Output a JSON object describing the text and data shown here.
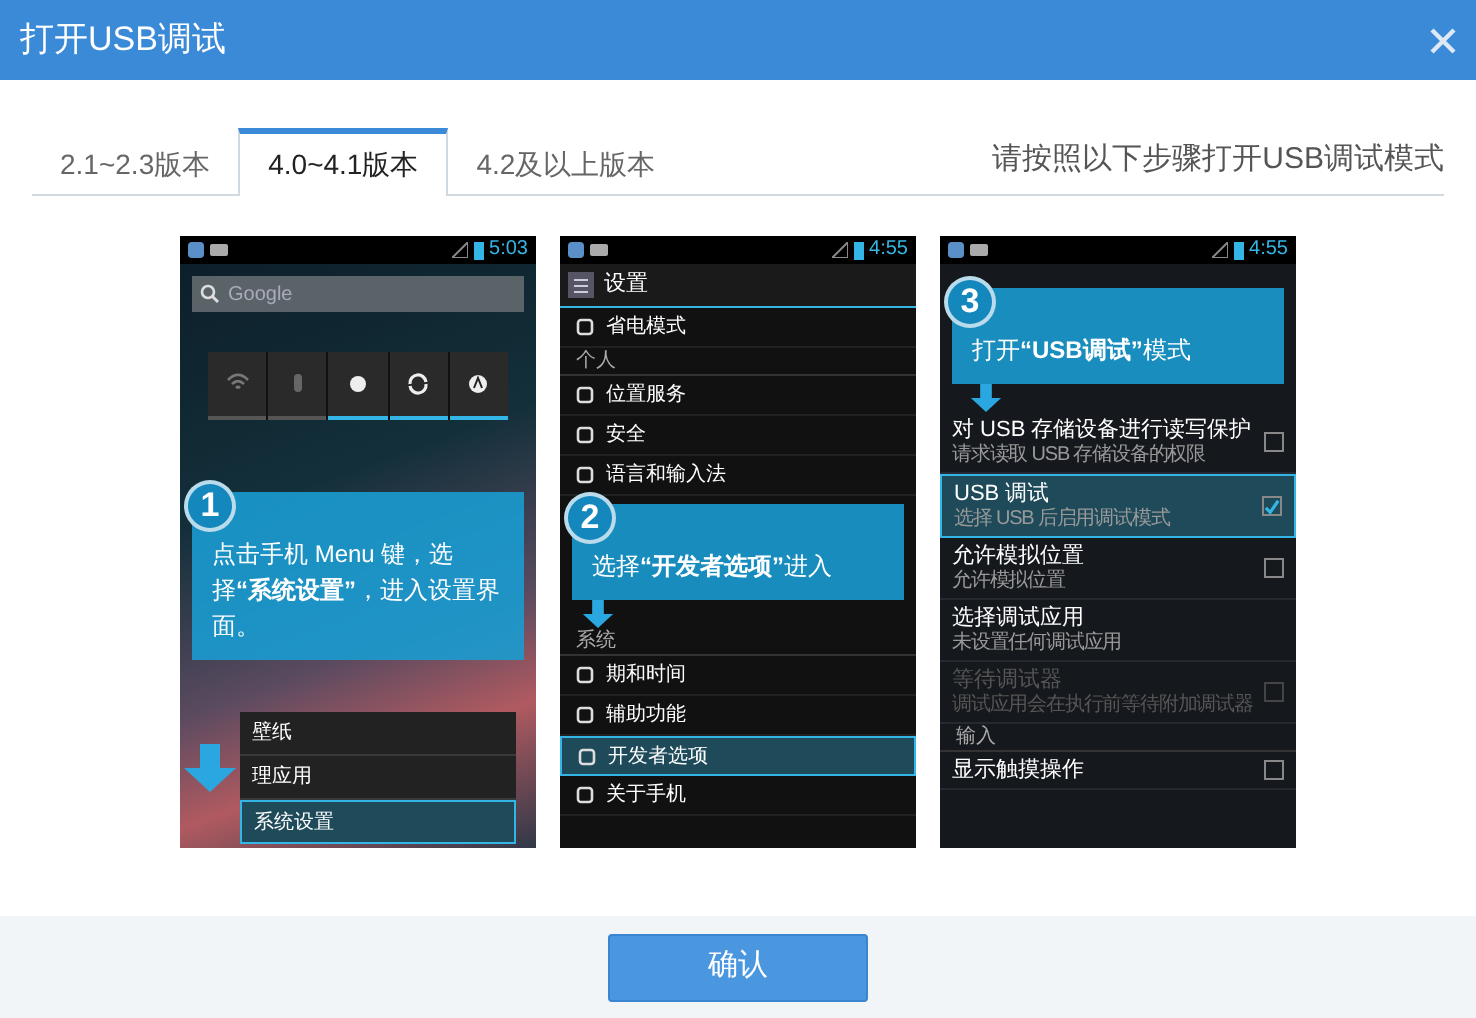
{
  "dialog": {
    "title": "打开USB调试"
  },
  "tabs": [
    {
      "label": "2.1~2.3版本",
      "selected": false
    },
    {
      "label": "4.0~4.1版本",
      "selected": true
    },
    {
      "label": "4.2及以上版本",
      "selected": false
    }
  ],
  "instruction": "请按照以下步骤打开USB调试模式",
  "steps": [
    {
      "kind": "home",
      "number": "1",
      "callout": "点击手机 Menu 键，选择**“系统设置”**，进入设置界面。",
      "status_time": "5:03",
      "search_placeholder": "Google",
      "toggles": [
        {
          "on": false
        },
        {
          "on": false
        },
        {
          "on": true
        },
        {
          "on": true
        },
        {
          "on": true
        }
      ],
      "menu": [
        {
          "label": "壁纸",
          "selected": false
        },
        {
          "label": "理应用",
          "selected": false
        },
        {
          "label": "系统设置",
          "selected": true
        }
      ]
    },
    {
      "kind": "settings",
      "number": "2",
      "callout": "选择**“开发者选项”**进入",
      "status_time": "4:55",
      "screen_title": "设置",
      "items_above": [
        {
          "kind": "item",
          "label": "省电模式",
          "selected": false
        },
        {
          "kind": "section",
          "label": "个人"
        },
        {
          "kind": "item",
          "label": "位置服务",
          "selected": false
        },
        {
          "kind": "item",
          "label": "安全",
          "selected": false
        },
        {
          "kind": "item",
          "label": "语言和输入法",
          "selected": false
        }
      ],
      "items_below": [
        {
          "kind": "section",
          "label": "系统"
        },
        {
          "kind": "item",
          "label": "期和时间",
          "selected": false
        },
        {
          "kind": "item",
          "label": "辅助功能",
          "selected": false
        },
        {
          "kind": "item",
          "label": "开发者选项",
          "selected": true
        },
        {
          "kind": "item",
          "label": "关于手机",
          "selected": false
        }
      ]
    },
    {
      "kind": "developer",
      "number": "3",
      "callout": "打开**“USB调试”**模式",
      "status_time": "4:55",
      "items": [
        {
          "kind": "check",
          "label": "对 USB 存储设备进行读写保护",
          "subtitle": "请求读取 USB 存储设备的权限",
          "checked": false,
          "selected": false,
          "disabled": false
        },
        {
          "kind": "check",
          "label": "USB 调试",
          "subtitle": "选择 USB 后启用调试模式",
          "checked": true,
          "selected": true,
          "disabled": false
        },
        {
          "kind": "check",
          "label": "允许模拟位置",
          "subtitle": "允许模拟位置",
          "checked": false,
          "selected": false,
          "disabled": false
        },
        {
          "kind": "plain",
          "label": "选择调试应用",
          "subtitle": "未设置任何调试应用",
          "selected": false,
          "disabled": false
        },
        {
          "kind": "check",
          "label": "等待调试器",
          "subtitle": "调试应用会在执行前等待附加调试器",
          "checked": false,
          "selected": false,
          "disabled": true
        },
        {
          "kind": "section",
          "label": "输入"
        },
        {
          "kind": "check",
          "label": "显示触摸操作",
          "checked": false,
          "selected": false,
          "disabled": false
        }
      ]
    }
  ],
  "confirm_button": "确认"
}
